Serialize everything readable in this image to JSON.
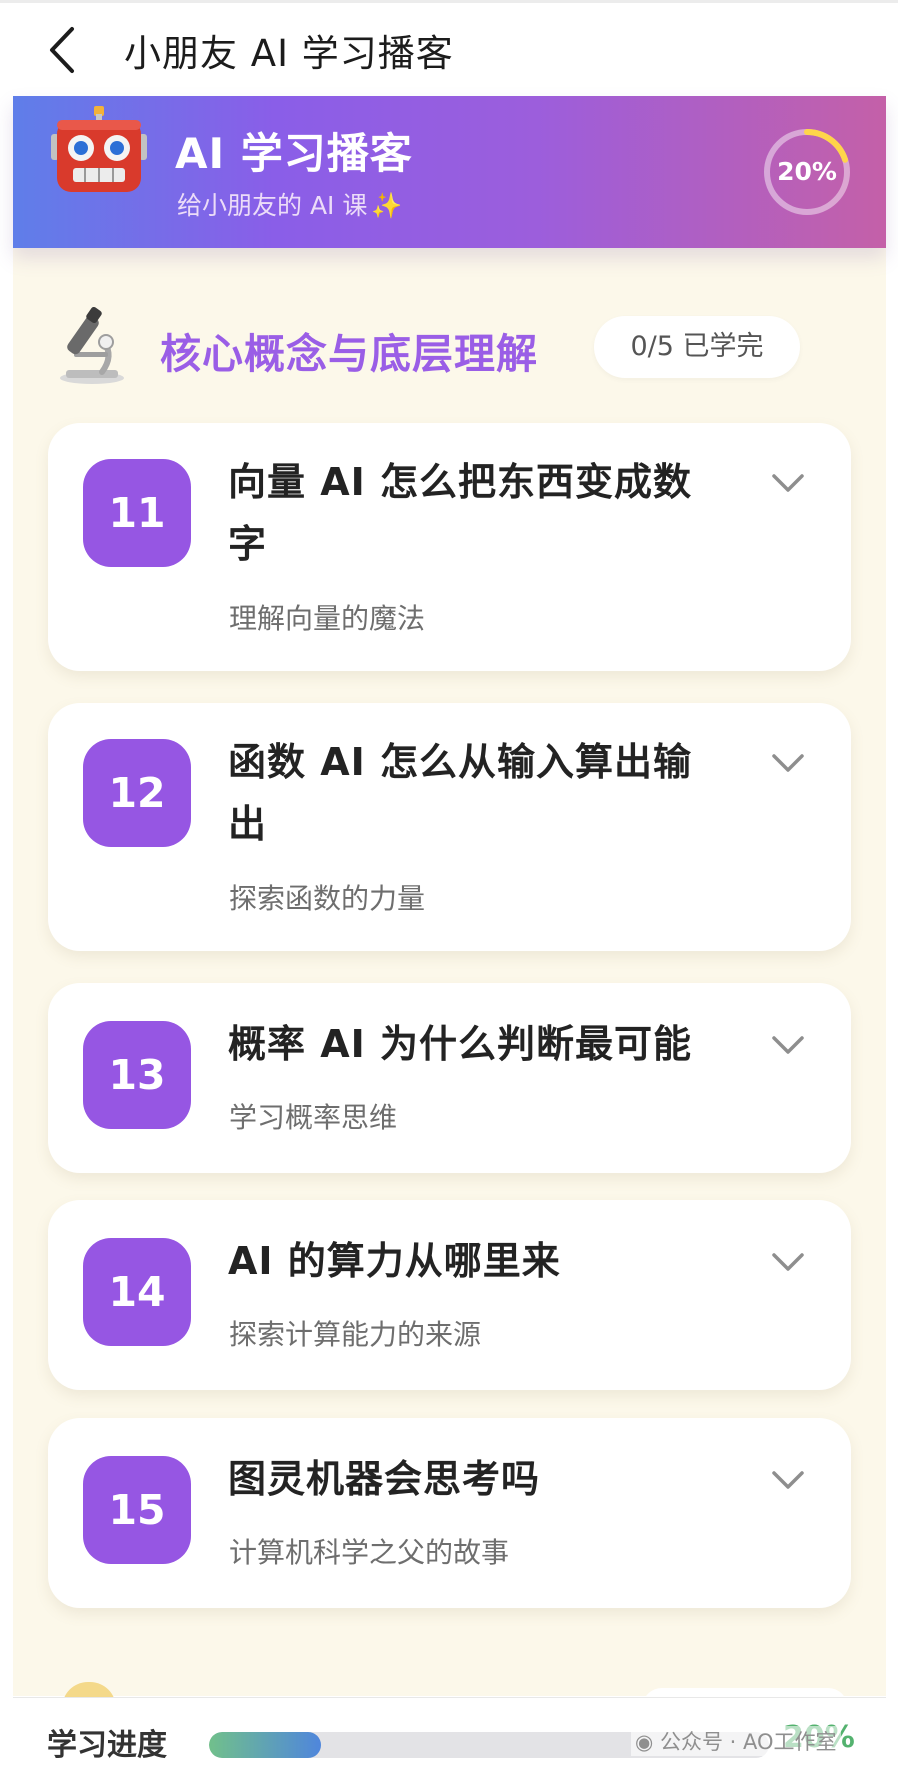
{
  "app": {
    "title": "小朋友 AI 学习播客"
  },
  "hero": {
    "title": "AI 学习播客",
    "subtitle": "给小朋友的 AI 课",
    "sparkle": "✨",
    "progress_label": "20%",
    "progress_fraction": 0.2
  },
  "section": {
    "title": "核心概念与底层理解",
    "badge": "0/5 已学完"
  },
  "lessons": [
    {
      "num": "11",
      "title": "向量 AI 怎么把东西变成数字",
      "subtitle": "理解向量的魔法"
    },
    {
      "num": "12",
      "title": "函数 AI 怎么从输入算出输出",
      "subtitle": "探索函数的力量"
    },
    {
      "num": "13",
      "title": "概率 AI 为什么判断最可能",
      "subtitle": "学习概率思维"
    },
    {
      "num": "14",
      "title": "AI 的算力从哪里来",
      "subtitle": "探索计算能力的来源"
    },
    {
      "num": "15",
      "title": "图灵机器会思考吗",
      "subtitle": "计算机科学之父的故事"
    }
  ],
  "bottom": {
    "label": "学习进度",
    "percent_label": "20%",
    "progress_fraction": 0.2,
    "watermark": "公众号 · AO工作室"
  },
  "colors": {
    "accent_purple": "#9656e3",
    "section_title": "#9a5ee6",
    "progress_green": "#54b26f",
    "page_background": "#fcf8ea"
  },
  "icons": {
    "back": "chevron-left-icon",
    "hero": "robot-icon",
    "section": "microscope-icon",
    "lesson_expand": "chevron-down-icon",
    "watermark": "wechat-icon"
  }
}
